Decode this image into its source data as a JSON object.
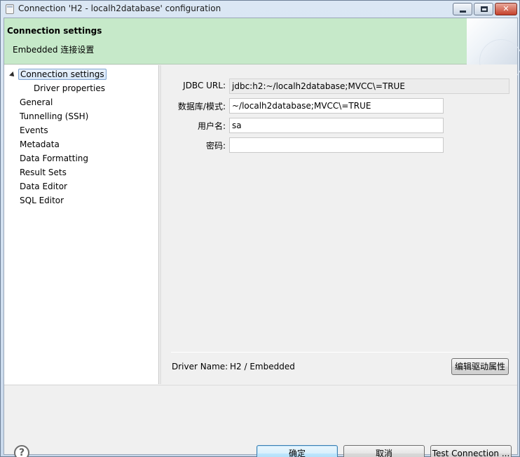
{
  "window": {
    "title": "Connection 'H2 - localh2database' configuration",
    "minimize_icon": "minimize-icon",
    "maximize_icon": "maximize-icon",
    "close_glyph": "✕"
  },
  "banner": {
    "title": "Connection settings",
    "subtitle": "Embedded 连接设置"
  },
  "tree": {
    "items": [
      {
        "label": "Connection settings",
        "expanded": true,
        "selected": true
      },
      {
        "label": "Driver properties",
        "child": true
      },
      {
        "label": "General"
      },
      {
        "label": "Tunnelling (SSH)"
      },
      {
        "label": "Events"
      },
      {
        "label": "Metadata"
      },
      {
        "label": "Data Formatting"
      },
      {
        "label": "Result Sets"
      },
      {
        "label": "Data Editor"
      },
      {
        "label": "SQL Editor"
      }
    ]
  },
  "form": {
    "jdbc_label": "JDBC URL:",
    "jdbc_value": "jdbc:h2:~/localh2database;MVCC\\=TRUE",
    "db_label": "数据库/模式:",
    "db_value": "~/localh2database;MVCC\\=TRUE",
    "user_label": "用户名:",
    "user_value": "sa",
    "password_label": "密码:",
    "password_value": ""
  },
  "driver": {
    "name_label": "Driver Name:",
    "name_value": "H2 / Embedded",
    "edit_button": "编辑驱动属性"
  },
  "footer": {
    "help_glyph": "?",
    "ok_button": "确定",
    "cancel_button": "取消",
    "test_button": "Test Connection ..."
  },
  "colors": {
    "banner": "#c6e9c9",
    "selection": "#d6e6f8"
  }
}
